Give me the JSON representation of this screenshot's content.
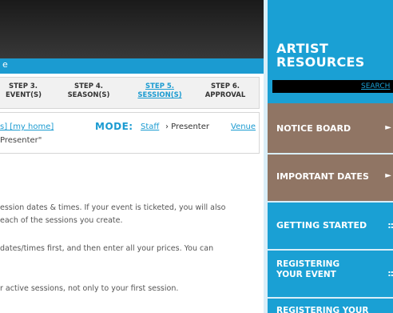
{
  "header": {
    "subbar_text": "e"
  },
  "steps": [
    {
      "line1": "STEP 3.",
      "line2": "EVENT(S)",
      "active": false
    },
    {
      "line1": "STEP 4.",
      "line2": "SEASON(S)",
      "active": false
    },
    {
      "line1": "STEP 5.",
      "line2": "SESSION(S)",
      "active": true
    },
    {
      "line1": "STEP 6.",
      "line2": "APPROVAL",
      "active": false
    }
  ],
  "mode_bar": {
    "links_text": "s] [my home]",
    "mode_label": "MODE:",
    "staff_link": "Staff",
    "presenter_text": "› Presenter",
    "venue_link": "Venue",
    "quote_text": "Presenter\""
  },
  "body_text": {
    "p1_line1": "ession dates & times. If your event is ticketed, you will also",
    "p1_line2": "each of the sessions you create.",
    "p2_line1": " dates/times first, and then enter all your prices. You can",
    "p3_line1": "r active sessions, not only to your first session."
  },
  "sidebar": {
    "title_line1": "ARTIST",
    "title_line2": "RESOURCES",
    "search_value": "",
    "search_label": "SEARCH",
    "items": [
      {
        "label": "NOTICE BOARD",
        "marker": "►",
        "color": "#907564"
      },
      {
        "label": "IMPORTANT DATES",
        "marker": "►",
        "color": "#907564"
      },
      {
        "label": "GETTING STARTED",
        "marker": "::",
        "color": "#1aa0d4"
      },
      {
        "label_line1": "REGISTERING",
        "label_line2": "YOUR EVENT",
        "marker": "::",
        "color": "#1aa0d4"
      },
      {
        "label": "REGISTERING YOUR",
        "color": "#1aa0d4"
      }
    ]
  }
}
